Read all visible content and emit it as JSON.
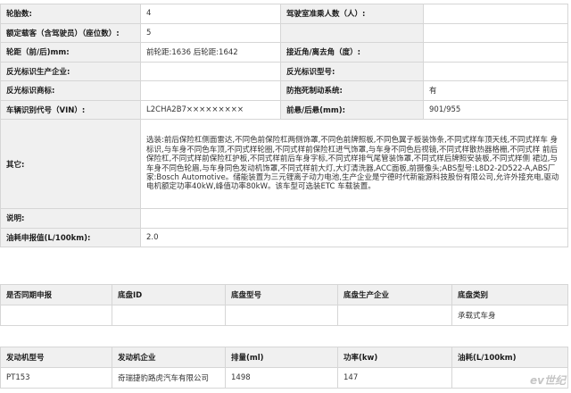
{
  "spec": [
    {
      "l1": "轮胎数:",
      "v1": "4",
      "l2": "驾驶室准乘人数（人）:",
      "v2": ""
    },
    {
      "l1": "额定载客（含驾驶员）（座位数）:",
      "v1": "5",
      "l2": "",
      "v2": ""
    },
    {
      "l1": "轮距（前/后)mm:",
      "v1": "前轮距:1636 后轮距:1642",
      "l2": "接近角/离去角（度）:",
      "v2": ""
    },
    {
      "l1": "反光标识生产企业:",
      "v1": "",
      "l2": "反光标识型号:",
      "v2": ""
    },
    {
      "l1": "反光标识商标:",
      "v1": "",
      "l2": "防抱死制动系统:",
      "v2": "有"
    },
    {
      "l1": "车辆识别代号（VIN）:",
      "v1": "L2CHA2B7×××××××××",
      "l2": "前悬/后悬(mm):",
      "v2": "901/955"
    }
  ],
  "other": {
    "label": "其它:",
    "text": "选装:前后保险杠侧面雷达,不同色前保险杠两侧饰罩,不同色前牌照板,不同色翼子板装饰条,不同式样车顶天线,不同式样车 身标识,与车身不同色车顶,不同式样轮圈,不同式样前保险杠进气饰罩,与车身不同色后视镜,不同式样散热器格栅,不同式样 前后保险杠,不同式样前保险杠护板,不同式样前后车身字标,不同式样排气尾管装饰罩,不同式样后牌照安装板,不同式样侧 裙边,与车身不同色轮眉,与车身同色发动机饰罩,不同式样前大灯,大灯清洗器,ACC面板,前摄像头;ABS型号:L8D2-2D522-A,ABS厂家:Bosch Automotive。储能装置为三元锂离子动力电池,生产企业是宁德时代新能源科技股份有限公司,允许外接充电,驱动电机额定功率40kW,峰值功率80kW。该车型可选装ETC 车载装置。"
  },
  "notes": {
    "label": "说明:",
    "value": ""
  },
  "fuel": {
    "label": "油耗申报值(L/100km):",
    "value": "2.0"
  },
  "chassis": {
    "headers": [
      "是否同期申报",
      "底盘ID",
      "底盘型号",
      "底盘生产企业",
      "底盘类别"
    ],
    "row": [
      "",
      "",
      "",
      "",
      "承载式车身"
    ]
  },
  "engine": {
    "headers": [
      "发动机型号",
      "发动机企业",
      "排量(ml)",
      "功率(kw)",
      "油耗(L/100km)"
    ],
    "row": [
      "PT153",
      "奇瑞捷豹路虎汽车有限公司",
      "1498",
      "147",
      ""
    ]
  },
  "watermark": "ev世纪"
}
